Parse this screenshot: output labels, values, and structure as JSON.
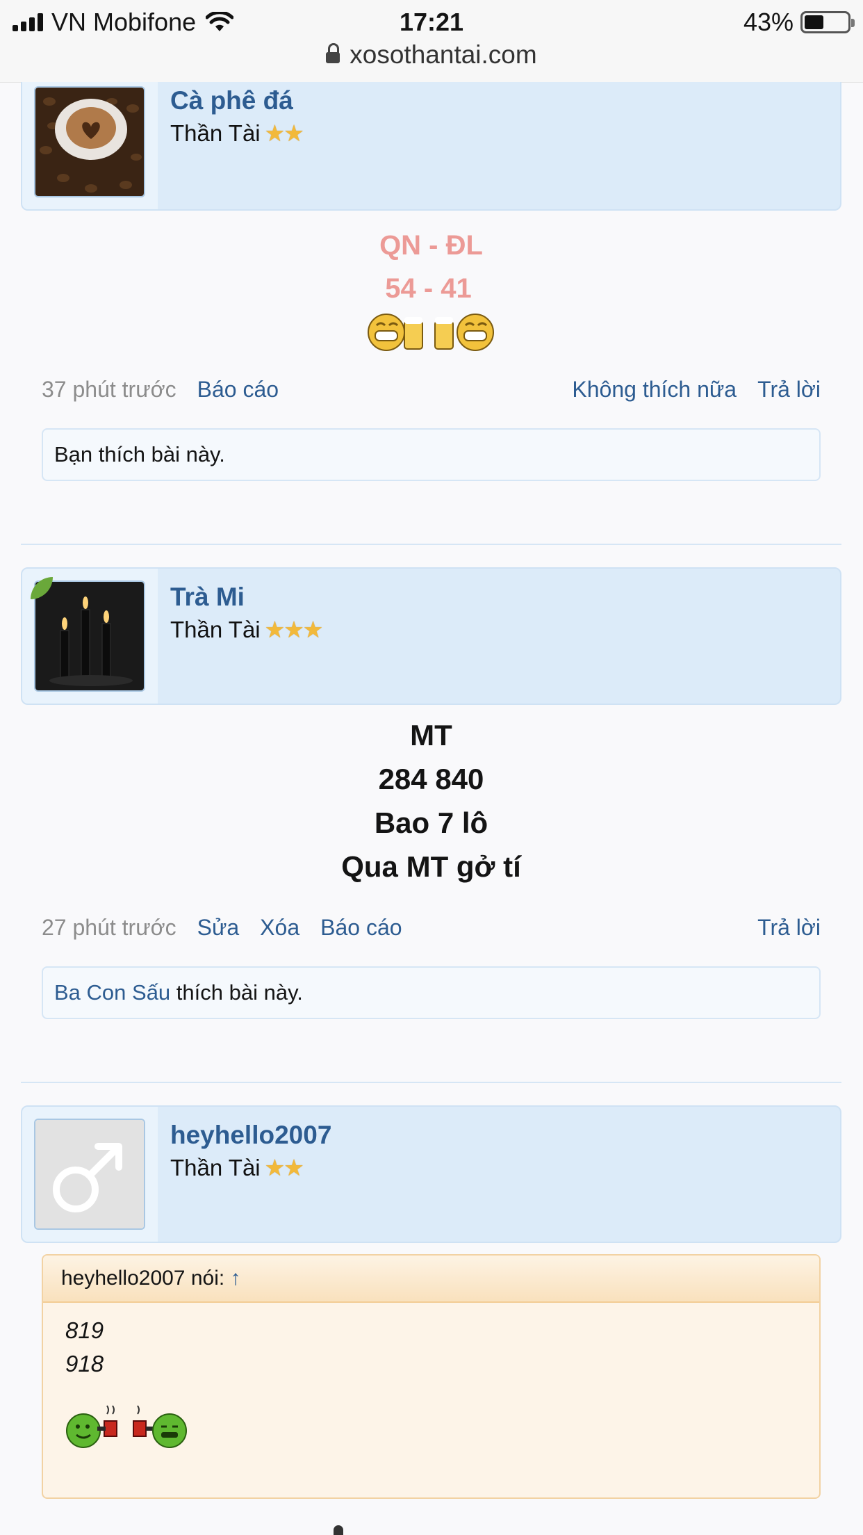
{
  "status": {
    "carrier": "VN Mobifone",
    "time": "17:21",
    "battery": "43%",
    "url": "xosothantai.com"
  },
  "posts": [
    {
      "username": "Cà phê đá",
      "rank": "Thần Tài",
      "stars": "★★",
      "lines": [
        "QN - ĐL",
        "54 - 41"
      ],
      "time": "37 phút trước",
      "actions_left": [
        "Báo cáo"
      ],
      "actions_right": [
        "Không thích nữa",
        "Trả lời"
      ],
      "likes_text": "Bạn thích bài này."
    },
    {
      "username": "Trà Mi",
      "rank": "Thần Tài",
      "stars": "★★★",
      "lines": [
        "MT",
        "284 840",
        "Bao 7 lô",
        "Qua MT gở tí"
      ],
      "time": "27 phút trước",
      "actions_left": [
        "Sửa",
        "Xóa",
        "Báo cáo"
      ],
      "actions_right": [
        "Trả lời"
      ],
      "likes_liker": "Ba Con Sấu",
      "likes_suffix": " thích bài này."
    },
    {
      "username": "heyhello2007",
      "rank": "Thần Tài",
      "stars": "★★",
      "quote_author": "heyhello2007 nói:",
      "quote_arrow": "↑",
      "quote_lines": [
        "819",
        "918"
      ]
    }
  ]
}
